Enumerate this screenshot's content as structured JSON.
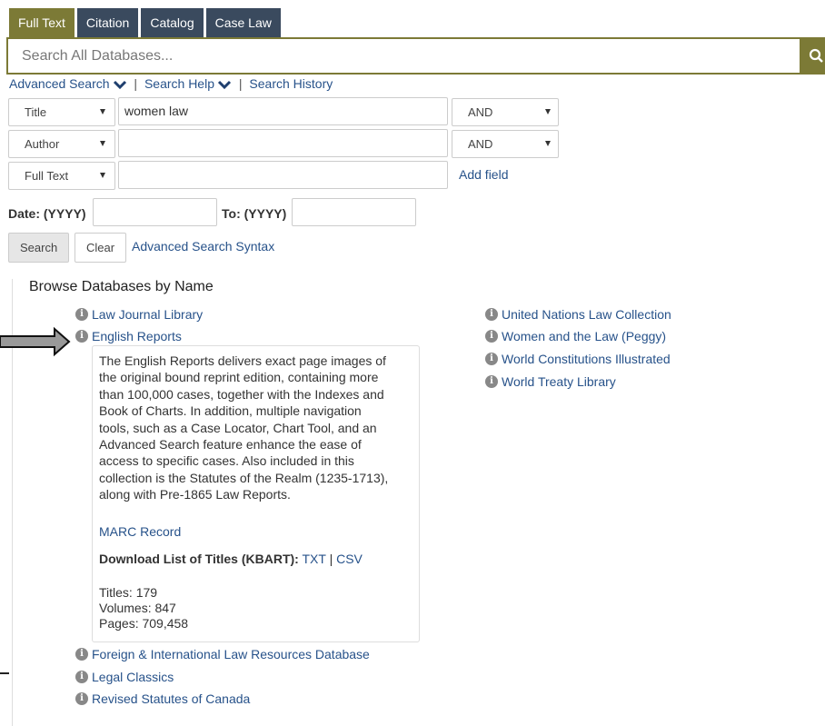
{
  "tabs": [
    {
      "label": "Full Text",
      "active": true
    },
    {
      "label": "Citation",
      "active": false
    },
    {
      "label": "Catalog",
      "active": false
    },
    {
      "label": "Case Law",
      "active": false
    }
  ],
  "search": {
    "placeholder": "Search All Databases...",
    "button_icon": "search-icon"
  },
  "links": {
    "advanced_search": "Advanced Search",
    "search_help": "Search Help",
    "separator": "|",
    "search_history": "Search History"
  },
  "fields": [
    {
      "type": "Title",
      "value": "women law",
      "operator": "AND"
    },
    {
      "type": "Author",
      "value": "",
      "operator": "AND"
    },
    {
      "type": "Full Text",
      "value": ""
    }
  ],
  "add_field": "Add field",
  "date": {
    "from_label": "Date: (YYYY)",
    "to_label": "To: (YYYY)"
  },
  "buttons": {
    "search": "Search",
    "clear": "Clear",
    "syntax": "Advanced Search Syntax"
  },
  "browse": {
    "title": "Browse Databases by Name",
    "left_items": [
      "Law Journal Library",
      "English Reports",
      "Foreign & International Law Resources Database",
      "Legal Classics",
      "Revised Statutes of Canada"
    ],
    "right_items": [
      "United Nations Law Collection",
      "Women and the Law (Peggy)",
      "World Constitutions Illustrated",
      "World Treaty Library"
    ],
    "detail": {
      "lines": [
        "The English Reports delivers exact page images of",
        "the original bound reprint edition, containing more",
        "than 100,000 cases, together with the Indexes and",
        "Book of Charts. In addition, multiple navigation",
        "tools, such as a Case Locator, Chart Tool, and an",
        "Advanced Search feature enhance the ease of",
        "access to specific cases. Also included in this",
        "collection is the Statutes of the Realm (1235-1713),",
        "along with Pre-1865 Law Reports."
      ],
      "marc_record": "MARC Record",
      "kbart_label": "Download List of Titles (KBART):",
      "txt": "TXT",
      "pipe": "|",
      "csv": "CSV",
      "titles": "Titles: 179",
      "volumes": "Volumes: 847",
      "pages": "Pages: 709,458"
    }
  },
  "colors": {
    "accent": "#7c7a36",
    "tab_dark": "#3a4a5e",
    "link": "#27528a"
  }
}
